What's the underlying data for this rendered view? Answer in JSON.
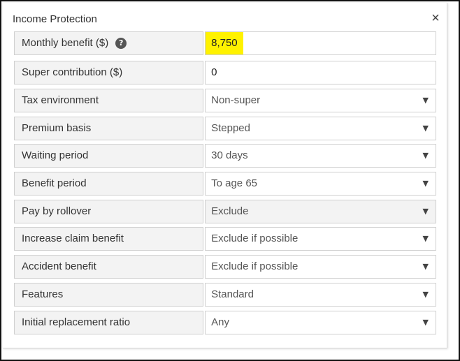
{
  "panel": {
    "title": "Income Protection",
    "close_glyph": "×"
  },
  "colors": {
    "highlight": "#fff200",
    "label_bg": "#f3f3f3",
    "border": "#cfcfcf"
  },
  "rows": [
    {
      "label": "Monthly benefit ($)",
      "value": "8,750",
      "kind": "input",
      "highlighted": true,
      "help_glyph": "?"
    },
    {
      "label": "Super contribution ($)",
      "value": "0",
      "kind": "input"
    },
    {
      "label": "Tax environment",
      "value": "Non-super",
      "kind": "select"
    },
    {
      "label": "Premium basis",
      "value": "Stepped",
      "kind": "select"
    },
    {
      "label": "Waiting period",
      "value": "30 days",
      "kind": "select"
    },
    {
      "label": "Benefit period",
      "value": "To age 65",
      "kind": "select"
    },
    {
      "label": "Pay by rollover",
      "value": "Exclude",
      "kind": "select",
      "disabled": true
    },
    {
      "label": "Increase claim benefit",
      "value": "Exclude if possible",
      "kind": "select"
    },
    {
      "label": "Accident benefit",
      "value": "Exclude if possible",
      "kind": "select"
    },
    {
      "label": "Features",
      "value": "Standard",
      "kind": "select"
    },
    {
      "label": "Initial replacement ratio",
      "value": "Any",
      "kind": "select"
    }
  ],
  "caret_glyph": "▼"
}
